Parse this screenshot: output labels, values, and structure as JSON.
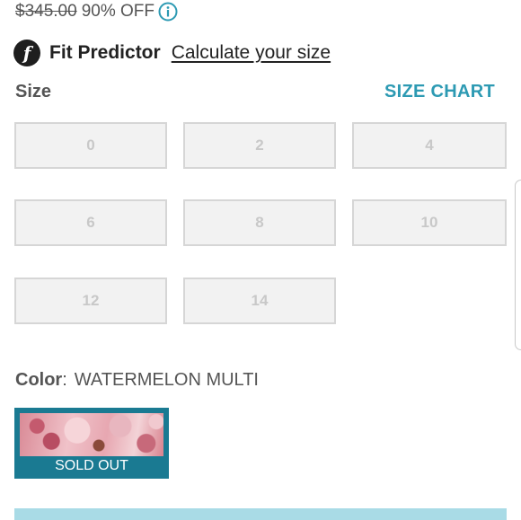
{
  "price": {
    "original": "$345.00",
    "discount": "90% OFF",
    "info_icon": "info-circle-icon"
  },
  "fit_predictor": {
    "logo_letter": "f",
    "title": "Fit Predictor",
    "link": "Calculate your size"
  },
  "size": {
    "label": "Size",
    "chart_link": "SIZE CHART",
    "options": [
      "0",
      "2",
      "4",
      "6",
      "8",
      "10",
      "12",
      "14"
    ]
  },
  "color": {
    "label": "Color",
    "separator": ":",
    "value": "WATERMELON MULTI",
    "swatch_status": "SOLD OUT"
  },
  "colors": {
    "accent": "#2d9ab3",
    "swatch_border": "#1a7a92",
    "disabled_bg": "#f2f2f2",
    "disabled_text": "#c8c8c8",
    "add_bar": "#a9dbe6"
  }
}
